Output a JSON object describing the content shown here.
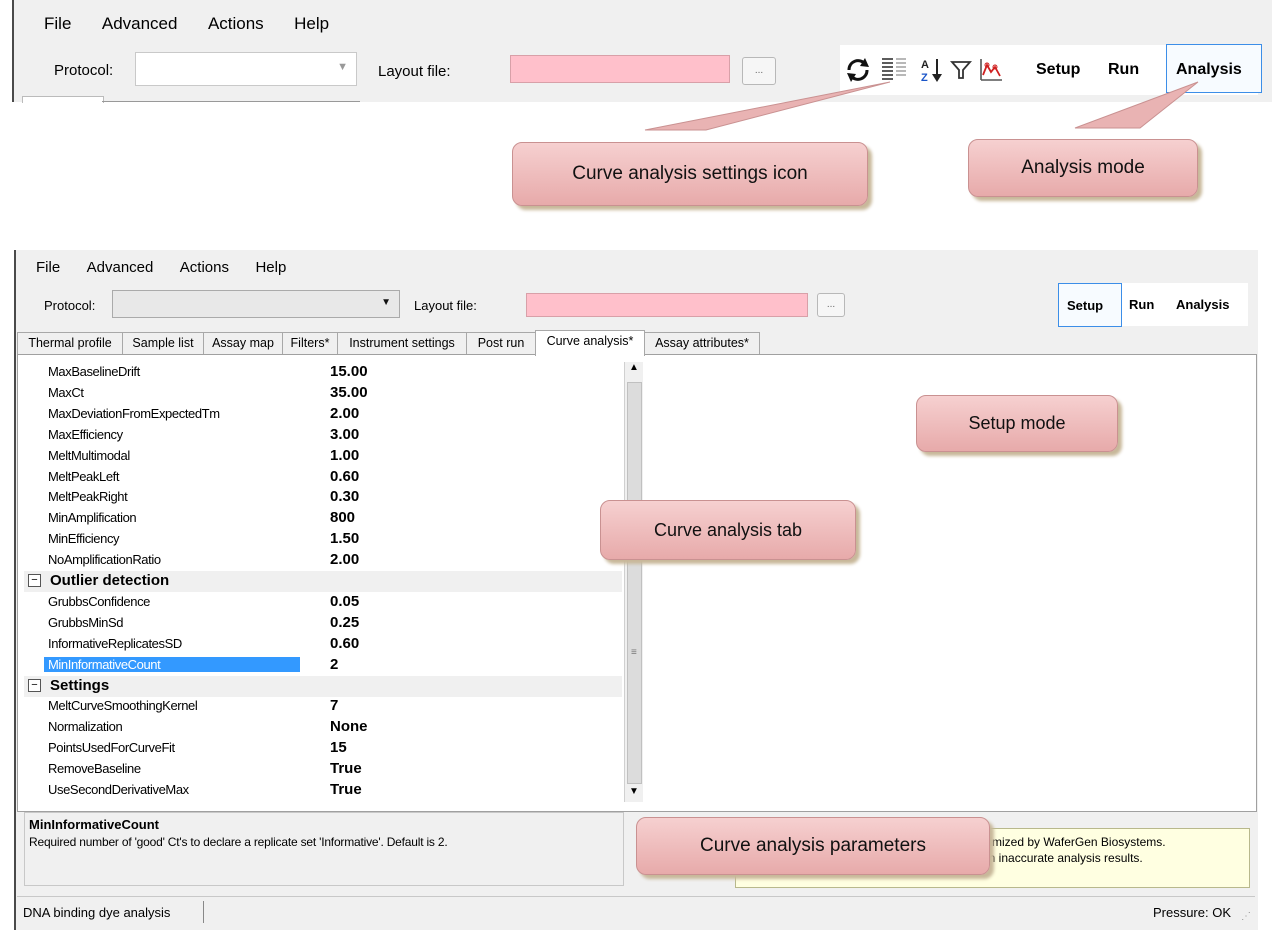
{
  "top": {
    "menu": [
      "File",
      "Advanced",
      "Actions",
      "Help"
    ],
    "protocol_label": "Protocol:",
    "layout_label": "Layout file:",
    "browse_label": "...",
    "modes": [
      "Setup",
      "Run",
      "Analysis"
    ],
    "active_mode": "Analysis"
  },
  "callouts": {
    "settings_icon": "Curve analysis settings icon",
    "analysis_mode": "Analysis mode",
    "setup_mode": "Setup mode",
    "curve_tab": "Curve analysis tab",
    "parameters": "Curve analysis parameters"
  },
  "bottom": {
    "menu": [
      "File",
      "Advanced",
      "Actions",
      "Help"
    ],
    "protocol_label": "Protocol:",
    "layout_label": "Layout file:",
    "browse_label": "...",
    "modes": [
      "Setup",
      "Run",
      "Analysis"
    ],
    "active_mode": "Setup",
    "tabs": [
      "Thermal profile",
      "Sample list",
      "Assay map",
      "Filters*",
      "Instrument settings",
      "Post run",
      "Curve analysis*",
      "Assay attributes*"
    ],
    "active_tab": "Curve analysis*",
    "grid": [
      {
        "type": "prop",
        "key": "MaxBaselineDrift",
        "value": "15.00"
      },
      {
        "type": "prop",
        "key": "MaxCt",
        "value": "35.00"
      },
      {
        "type": "prop",
        "key": "MaxDeviationFromExpectedTm",
        "value": "2.00"
      },
      {
        "type": "prop",
        "key": "MaxEfficiency",
        "value": "3.00"
      },
      {
        "type": "prop",
        "key": "MeltMultimodal",
        "value": "1.00"
      },
      {
        "type": "prop",
        "key": "MeltPeakLeft",
        "value": "0.60"
      },
      {
        "type": "prop",
        "key": "MeltPeakRight",
        "value": "0.30"
      },
      {
        "type": "prop",
        "key": "MinAmplification",
        "value": "800"
      },
      {
        "type": "prop",
        "key": "MinEfficiency",
        "value": "1.50"
      },
      {
        "type": "prop",
        "key": "NoAmplificationRatio",
        "value": "2.00"
      },
      {
        "type": "cat",
        "key": "Outlier detection"
      },
      {
        "type": "prop",
        "key": "GrubbsConfidence",
        "value": "0.05"
      },
      {
        "type": "prop",
        "key": "GrubbsMinSd",
        "value": "0.25"
      },
      {
        "type": "prop",
        "key": "InformativeReplicatesSD",
        "value": "0.60"
      },
      {
        "type": "prop",
        "key": "MinInformativeCount",
        "value": "2",
        "selected": true
      },
      {
        "type": "cat",
        "key": "Settings"
      },
      {
        "type": "prop",
        "key": "MeltCurveSmoothingKernel",
        "value": "7"
      },
      {
        "type": "prop",
        "key": "Normalization",
        "value": "None"
      },
      {
        "type": "prop",
        "key": "PointsUsedForCurveFit",
        "value": "15"
      },
      {
        "type": "prop",
        "key": "RemoveBaseline",
        "value": "True"
      },
      {
        "type": "prop",
        "key": "UseSecondDerivativeMax",
        "value": "True"
      }
    ],
    "description": {
      "title": "MinInformativeCount",
      "text": "Required number of 'good' Ct's to declare a replicate set 'Informative'. Default is 2."
    },
    "warning": {
      "line1": "timized by WaferGen Biosystems.",
      "line2": "in inaccurate analysis results."
    },
    "status": {
      "left": "DNA binding dye analysis",
      "right": "Pressure: OK"
    }
  }
}
